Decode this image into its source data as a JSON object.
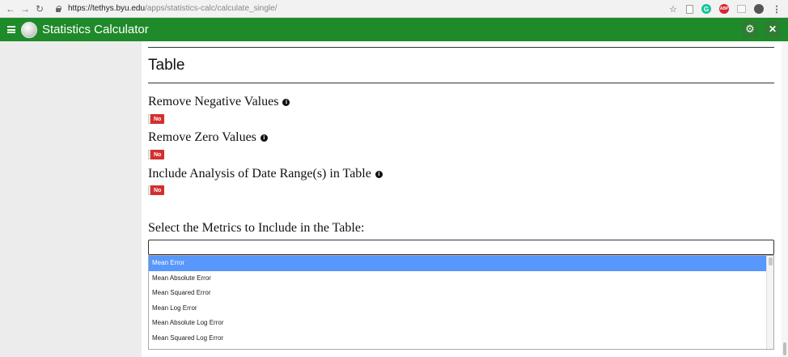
{
  "browser": {
    "url_host": "https://tethys.byu.edu",
    "url_path": "/apps/statistics-calc/calculate_single/"
  },
  "app": {
    "title": "Statistics Calculator",
    "header_color": "#1f8a2a"
  },
  "section": {
    "title": "Table"
  },
  "options": [
    {
      "label": "Remove Negative Values",
      "value": "No"
    },
    {
      "label": "Remove Zero Values",
      "value": "No"
    },
    {
      "label": "Include Analysis of Date Range(s) in Table",
      "value": "No"
    }
  ],
  "metrics": {
    "label": "Select the Metrics to Include in the Table:",
    "search_value": "",
    "items": [
      {
        "label": "Mean Error",
        "highlighted": true
      },
      {
        "label": "Mean Absolute Error",
        "highlighted": false
      },
      {
        "label": "Mean Squared Error",
        "highlighted": false
      },
      {
        "label": "Mean Log Error",
        "highlighted": false
      },
      {
        "label": "Mean Absolute Log Error",
        "highlighted": false
      },
      {
        "label": "Mean Squared Log Error",
        "highlighted": false
      }
    ],
    "highlight_color": "#5897fb"
  },
  "icons": {
    "back": "arrow-left-icon",
    "forward": "arrow-right-icon",
    "reload": "reload-icon",
    "bookmark": "star-icon",
    "settings": "gear-icon",
    "close": "close-icon",
    "menu": "hamburger-icon",
    "info": "info-icon"
  },
  "toggle_off_color": "#d32f2f"
}
